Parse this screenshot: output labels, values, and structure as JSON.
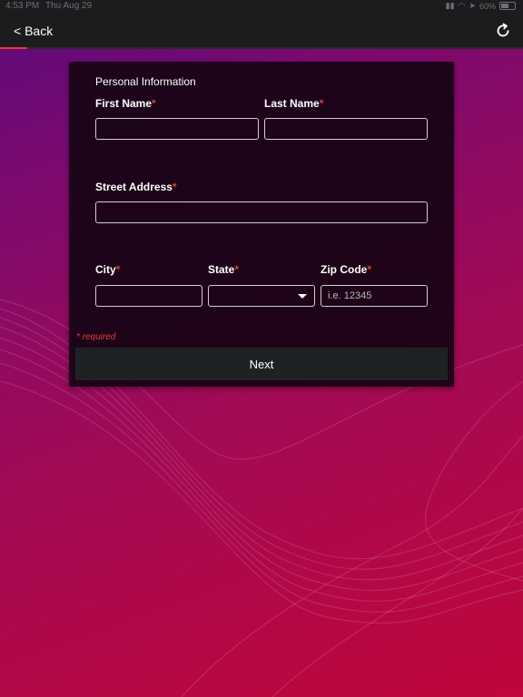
{
  "status_bar": {
    "time": "4:53 PM",
    "date": "Thu Aug 29",
    "battery": "60%"
  },
  "nav": {
    "back_label": "< Back",
    "refresh_icon": "refresh-icon"
  },
  "form": {
    "section_title": "Personal Information",
    "required_mark": "*",
    "fields": {
      "first_name": {
        "label": "First Name",
        "value": "",
        "placeholder": ""
      },
      "last_name": {
        "label": "Last Name",
        "value": "",
        "placeholder": ""
      },
      "street_address": {
        "label": "Street Address",
        "value": "",
        "placeholder": ""
      },
      "city": {
        "label": "City",
        "value": "",
        "placeholder": ""
      },
      "state": {
        "label": "State",
        "value": ""
      },
      "zip_code": {
        "label": "Zip Code",
        "value": "",
        "placeholder": "i.e. 12345"
      }
    },
    "required_note": "* required",
    "next_label": "Next"
  },
  "colors": {
    "accent": "#e2402e",
    "card_bg": "#160414",
    "button_bg": "#1f2224",
    "nav_bg": "#1c1c1e"
  }
}
